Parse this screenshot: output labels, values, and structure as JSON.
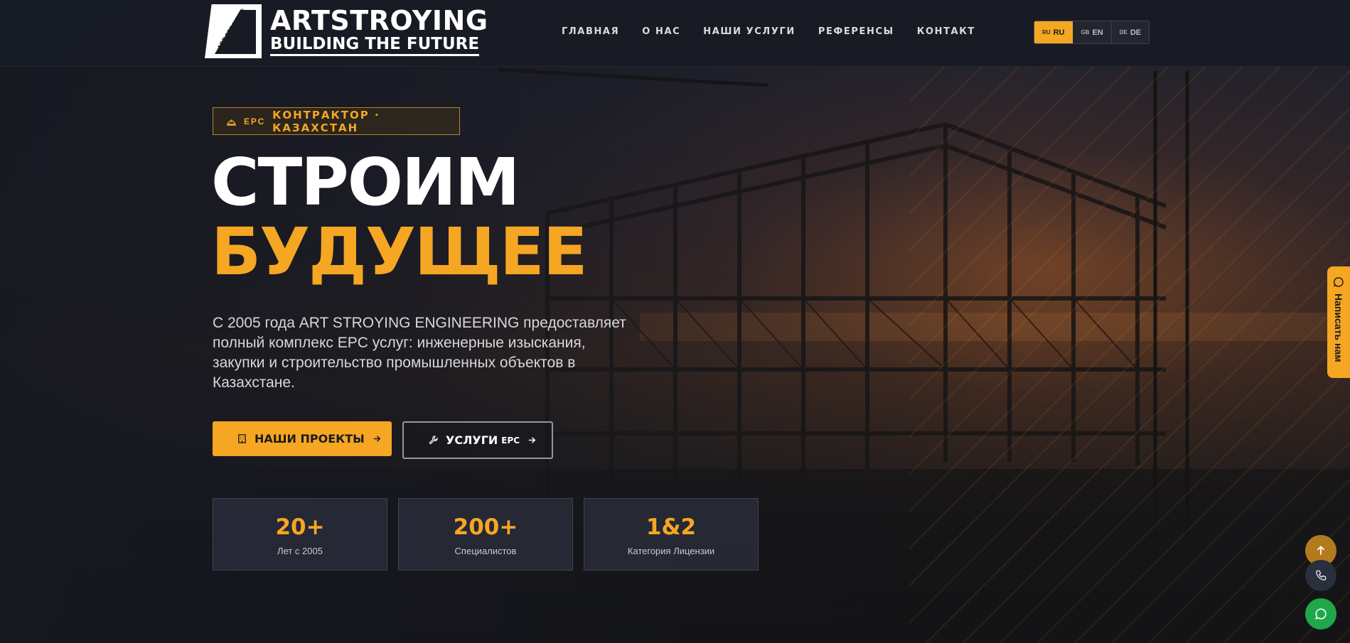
{
  "header": {
    "logo": {
      "title": "ARTSTROYING",
      "subtitle": "BUILDING THE FUTURE",
      "mark_text": "ART STROYING"
    },
    "nav": [
      {
        "label": "ГЛАВНАЯ"
      },
      {
        "label": "О НАС"
      },
      {
        "label": "НАШИ УСЛУГИ"
      },
      {
        "label": "РЕФЕРЕНСЫ"
      },
      {
        "label": "КОНТАКТ"
      }
    ],
    "languages": [
      {
        "flag": "RU",
        "label": "RU",
        "active": true
      },
      {
        "flag": "GB",
        "label": "EN",
        "active": false
      },
      {
        "flag": "DE",
        "label": "DE",
        "active": false
      }
    ]
  },
  "hero": {
    "badge": {
      "icon": "hard-hat-icon",
      "small": "EPC",
      "text": "КОНТРАКТОР · КАЗАХСТАН"
    },
    "title_line1": "СТРОИМ",
    "title_line2": "БУДУЩЕЕ",
    "lead": "С 2005 года ART STROYING ENGINEERING предоставляет полный комплекс EPC услуг: инженерные изыскания, закупки и строительство промышленных объектов в Казахстане.",
    "primary_button": {
      "icon": "building-icon",
      "label": "НАШИ ПРОЕКТЫ"
    },
    "secondary_button": {
      "icon": "wrench-icon",
      "label": "УСЛУГИ",
      "label_small": "EPC"
    },
    "stats": [
      {
        "value": "20+",
        "label": "Лет с 2005"
      },
      {
        "value": "200+",
        "label": "Специалистов"
      },
      {
        "value": "1&2",
        "label": "Категория Лицензии"
      }
    ]
  },
  "widgets": {
    "side_tab_label": "Написать нам",
    "accent_color": "#f5a623",
    "chat_color": "#1fa84a"
  }
}
